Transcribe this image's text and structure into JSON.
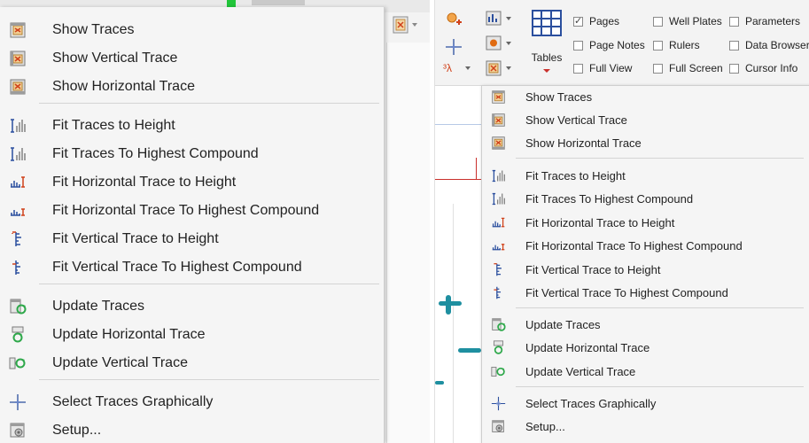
{
  "left_menu": {
    "items": [
      {
        "label": "Show Traces",
        "icon": "trace-grid-icon"
      },
      {
        "label": "Show Vertical Trace",
        "icon": "vertical-trace-icon"
      },
      {
        "label": "Show Horizontal Trace",
        "icon": "horizontal-trace-icon"
      },
      {
        "label": "Fit Traces to Height",
        "icon": "fit-height-icon"
      },
      {
        "label": "Fit Traces To Highest Compound",
        "icon": "fit-highest-icon"
      },
      {
        "label": "Fit Horizontal Trace to Height",
        "icon": "fit-horizontal-height-icon"
      },
      {
        "label": "Fit Horizontal Trace To Highest Compound",
        "icon": "fit-horizontal-highest-icon"
      },
      {
        "label": "Fit Vertical Trace to Height",
        "icon": "fit-vertical-height-icon"
      },
      {
        "label": "Fit Vertical Trace To Highest Compound",
        "icon": "fit-vertical-highest-icon"
      },
      {
        "label": "Update Traces",
        "icon": "update-traces-icon"
      },
      {
        "label": "Update Horizontal Trace",
        "icon": "update-horizontal-icon"
      },
      {
        "label": "Update Vertical Trace",
        "icon": "update-vertical-icon"
      },
      {
        "label": "Select Traces Graphically",
        "icon": "crosshair-icon"
      },
      {
        "label": "Setup...",
        "icon": "setup-icon"
      }
    ]
  },
  "ribbon": {
    "tables_label": "Tables",
    "checkboxes": [
      {
        "label": "Pages",
        "checked": true
      },
      {
        "label": "Well Plates",
        "checked": false
      },
      {
        "label": "Parameters",
        "checked": false
      },
      {
        "label": "Page Notes",
        "checked": false
      },
      {
        "label": "Rulers",
        "checked": false
      },
      {
        "label": "Data Browser",
        "checked": false
      },
      {
        "label": "Full View",
        "checked": false
      },
      {
        "label": "Full Screen",
        "checked": false
      },
      {
        "label": "Cursor Info",
        "checked": false
      }
    ]
  },
  "right_menu": {
    "items": [
      {
        "label": "Show Traces"
      },
      {
        "label": "Show Vertical Trace"
      },
      {
        "label": "Show Horizontal Trace"
      },
      {
        "label": "Fit Traces to Height"
      },
      {
        "label": "Fit Traces To Highest Compound"
      },
      {
        "label": "Fit Horizontal Trace to Height"
      },
      {
        "label": "Fit Horizontal Trace To Highest Compound"
      },
      {
        "label": "Fit Vertical Trace to Height"
      },
      {
        "label": "Fit Vertical Trace To Highest Compound"
      },
      {
        "label": "Update Traces"
      },
      {
        "label": "Update Horizontal Trace"
      },
      {
        "label": "Update Vertical Trace"
      },
      {
        "label": "Select Traces Graphically"
      },
      {
        "label": "Setup..."
      }
    ]
  },
  "colors": {
    "menu_bg": "#f5f5f5",
    "accent_orange": "#e06a10",
    "icon_blue": "#2b4f9e",
    "icon_green": "#2ea84a",
    "plot_teal": "#1e8fa0"
  }
}
